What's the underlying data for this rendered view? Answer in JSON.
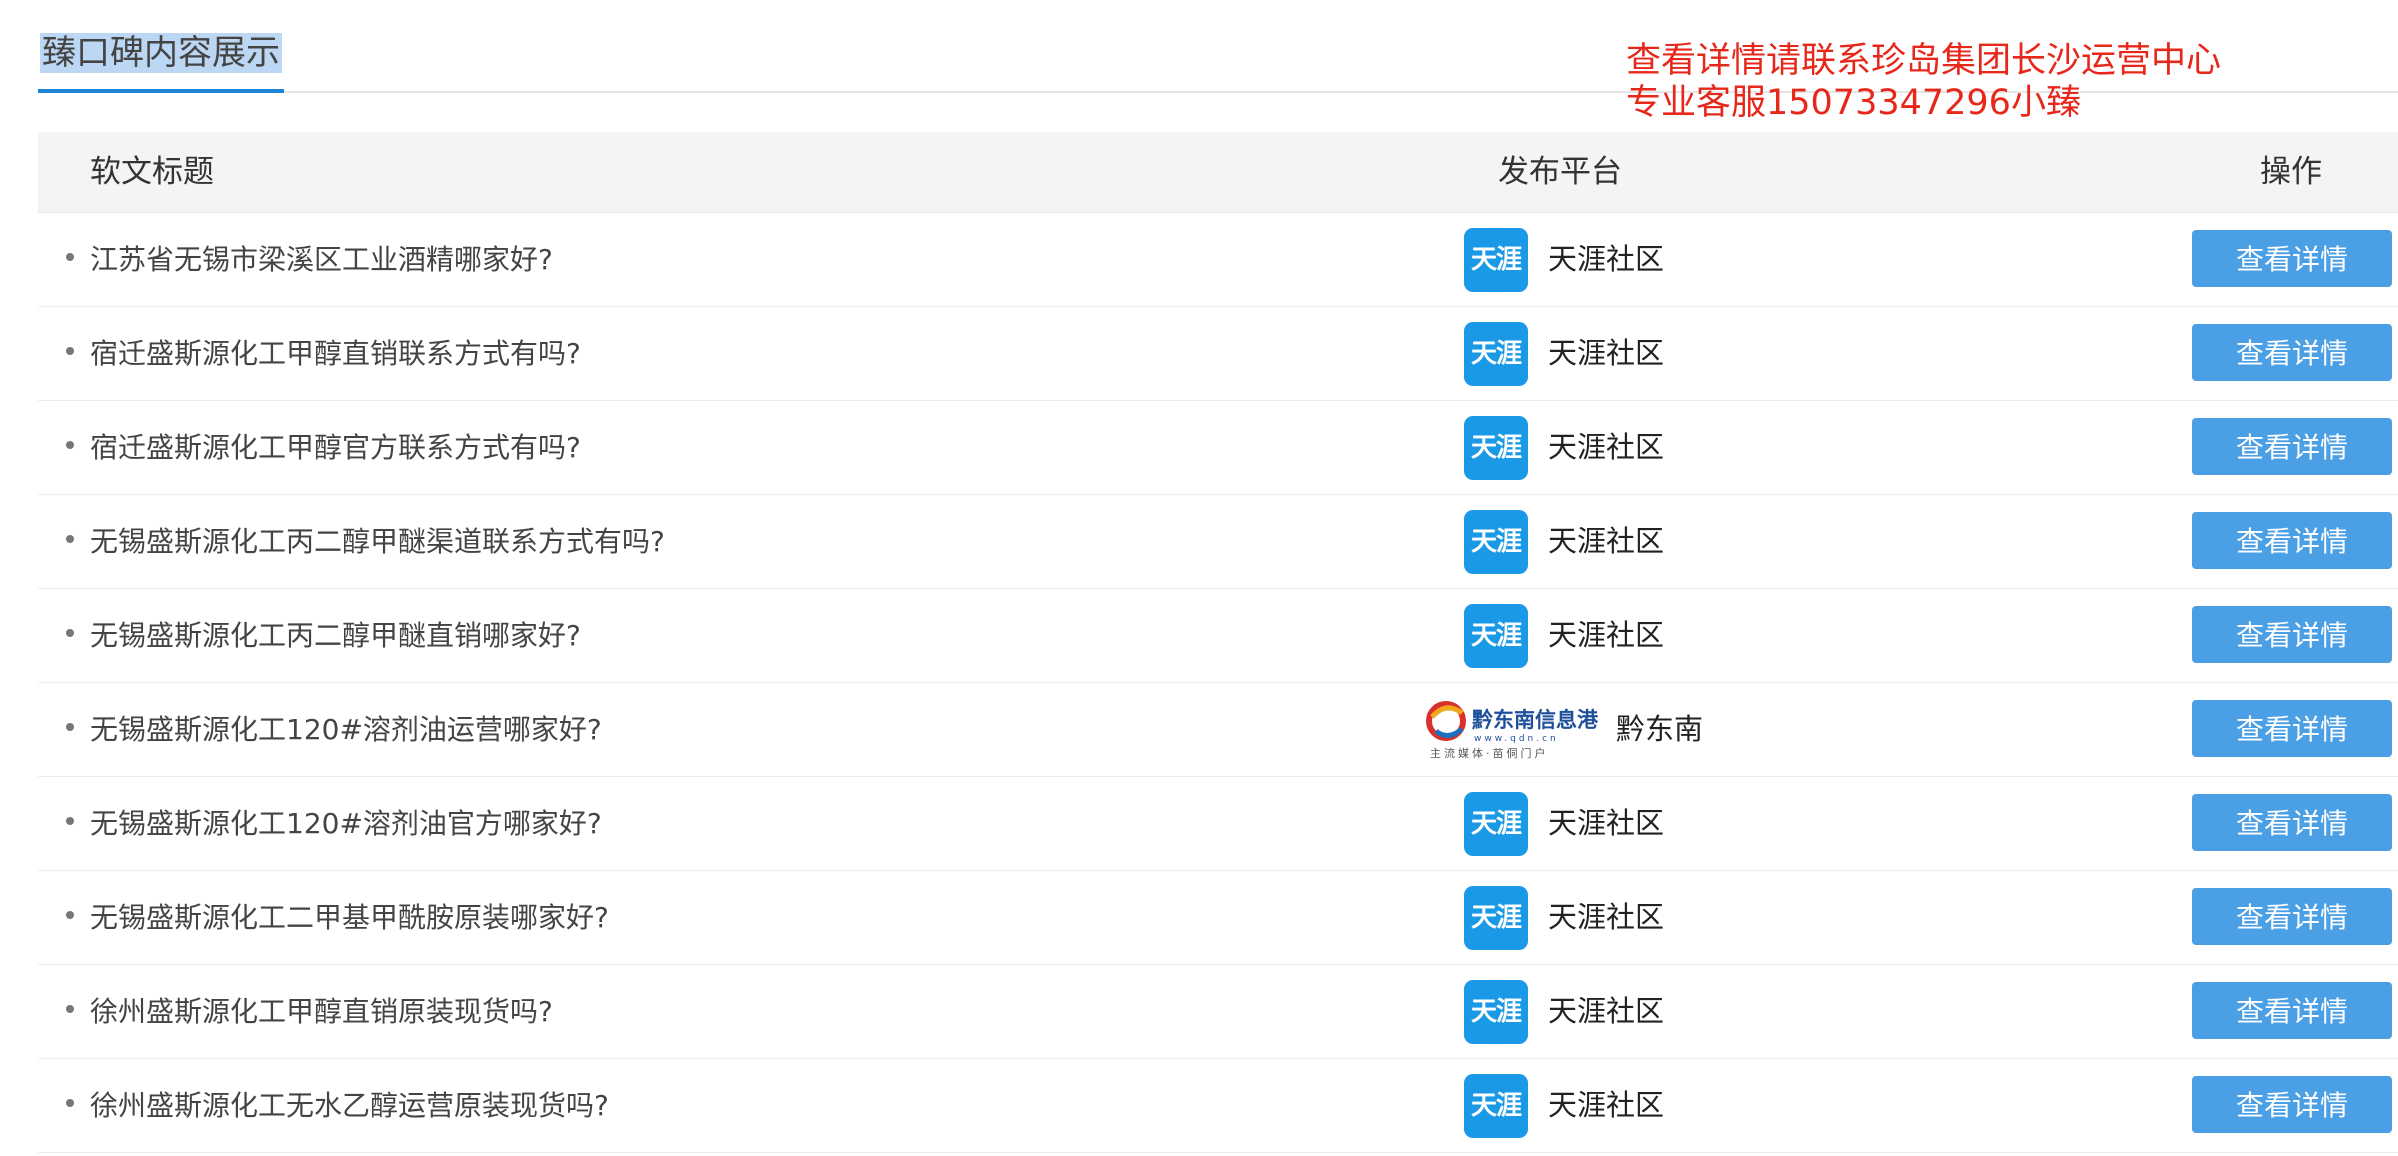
{
  "tab": {
    "label": "臻口碑内容展示"
  },
  "notice": {
    "line1": "查看详情请联系珍岛集团长沙运营中心",
    "line2": "专业客服15073347296小臻"
  },
  "table": {
    "headers": {
      "title": "软文标题",
      "platform": "发布平台",
      "ops": "操作"
    },
    "rows": [
      {
        "title": "江苏省无锡市梁溪区工业酒精哪家好?",
        "platform": "天涯社区",
        "logo": "tianya-logo-icon",
        "button": "查看详情"
      },
      {
        "title": "宿迁盛斯源化工甲醇直销联系方式有吗?",
        "platform": "天涯社区",
        "logo": "tianya-logo-icon",
        "button": "查看详情"
      },
      {
        "title": "宿迁盛斯源化工甲醇官方联系方式有吗?",
        "platform": "天涯社区",
        "logo": "tianya-logo-icon",
        "button": "查看详情"
      },
      {
        "title": "无锡盛斯源化工丙二醇甲醚渠道联系方式有吗?",
        "platform": "天涯社区",
        "logo": "tianya-logo-icon",
        "button": "查看详情"
      },
      {
        "title": "无锡盛斯源化工丙二醇甲醚直销哪家好?",
        "platform": "天涯社区",
        "logo": "tianya-logo-icon",
        "button": "查看详情"
      },
      {
        "title": "无锡盛斯源化工120#溶剂油运营哪家好?",
        "platform": "黔东南",
        "logo": "qdn-logo-icon",
        "button": "查看详情"
      },
      {
        "title": "无锡盛斯源化工120#溶剂油官方哪家好?",
        "platform": "天涯社区",
        "logo": "tianya-logo-icon",
        "button": "查看详情"
      },
      {
        "title": "无锡盛斯源化工二甲基甲酰胺原装哪家好?",
        "platform": "天涯社区",
        "logo": "tianya-logo-icon",
        "button": "查看详情"
      },
      {
        "title": "徐州盛斯源化工甲醇直销原装现货吗?",
        "platform": "天涯社区",
        "logo": "tianya-logo-icon",
        "button": "查看详情"
      },
      {
        "title": "徐州盛斯源化工无水乙醇运营原装现货吗?",
        "platform": "天涯社区",
        "logo": "tianya-logo-icon",
        "button": "查看详情"
      }
    ]
  },
  "logos": {
    "tianya": {
      "text": "天涯"
    },
    "qdn": {
      "name": "黔东南信息港",
      "url": "www.qdn.cn",
      "slogan": "主流媒体·苗侗门户"
    }
  },
  "colors": {
    "accent": "#1e84d8",
    "button": "#4a9fe5",
    "notice": "#e8271b",
    "tianya": "#1a9ae6"
  }
}
